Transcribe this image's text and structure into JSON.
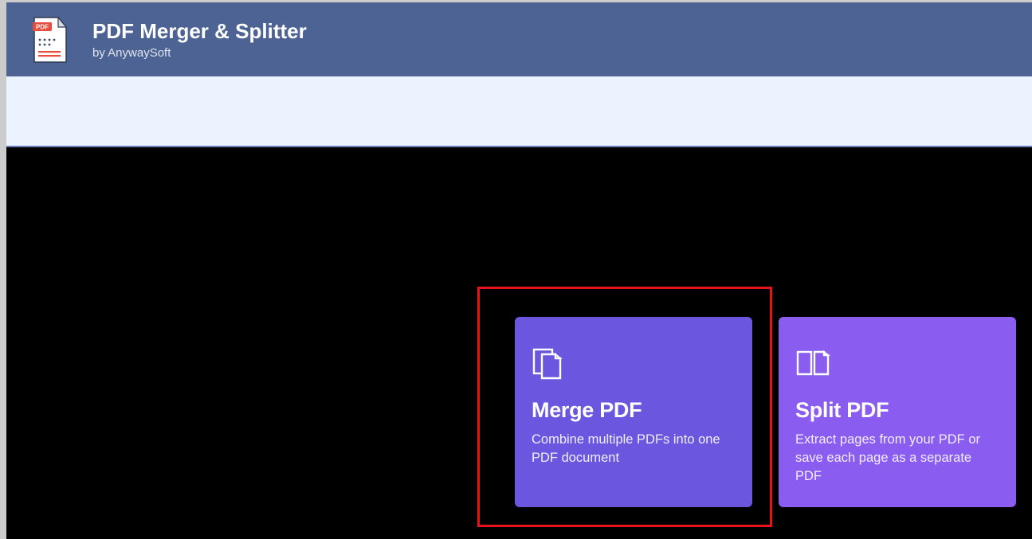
{
  "header": {
    "title": "PDF Merger & Splitter",
    "publisher": "by AnywaySoft"
  },
  "cards": {
    "merge": {
      "title": "Merge PDF",
      "description": "Combine multiple PDFs into one PDF document"
    },
    "split": {
      "title": "Split PDF",
      "description": "Extract pages from your PDF or save each page as a separate PDF"
    }
  },
  "colors": {
    "header_bg": "#4d6394",
    "merge_card_bg": "#6b57df",
    "split_card_bg": "#8b5cf0",
    "highlight_border": "#e6141a"
  }
}
